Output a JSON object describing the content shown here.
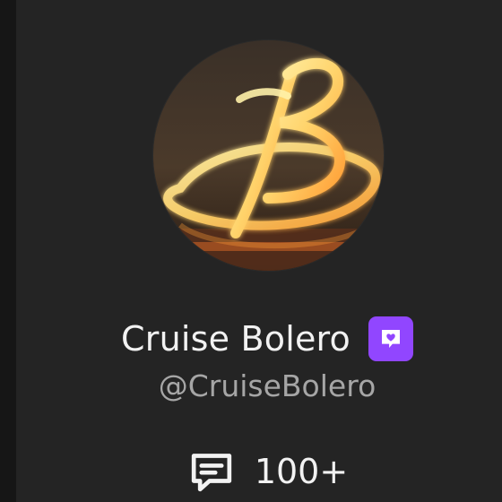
{
  "profile": {
    "display_name": "Cruise Bolero",
    "handle": "@CruiseBolero",
    "avatar_icon": "neon-b-logo-avatar",
    "badge_icon": "purple-chat-badge-icon"
  },
  "stats": {
    "comment_icon": "comment-icon",
    "count": "100+"
  },
  "colors": {
    "background": "#242424",
    "name_text": "#f2f2f2",
    "handle_text": "#a6a6a6",
    "badge": "#9146ff"
  }
}
